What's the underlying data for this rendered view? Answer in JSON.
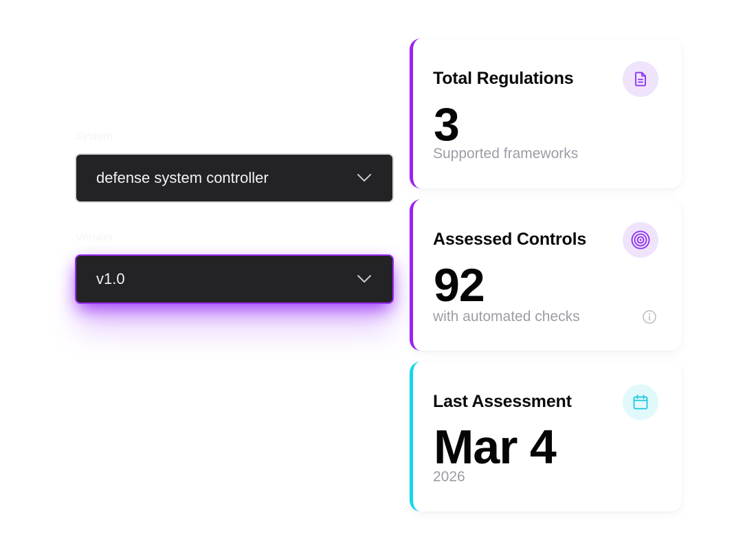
{
  "form": {
    "system_label": "System",
    "system_value": "defense system controller",
    "version_label": "Version",
    "version_value": "v1.0"
  },
  "cards": {
    "regulations": {
      "title": "Total Regulations",
      "value": "3",
      "subtitle": "Supported frameworks",
      "icon": "document-icon",
      "accent": "#9d21ee"
    },
    "controls": {
      "title": "Assessed Controls",
      "value": "92",
      "subtitle": "with automated checks",
      "icon": "target-icon",
      "info_icon": "info-icon",
      "accent": "#9d21ee"
    },
    "assessment": {
      "title": "Last Assessment",
      "value": "Mar 4",
      "subtitle": "2026",
      "icon": "calendar-icon",
      "accent": "#13d7ea"
    }
  }
}
